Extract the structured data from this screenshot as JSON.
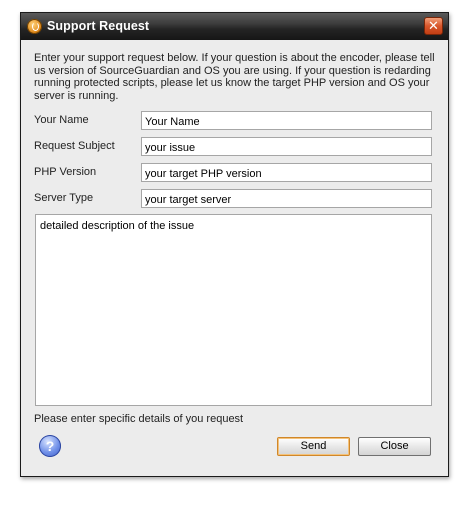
{
  "window": {
    "title": "Support Request",
    "close_glyph": "✕"
  },
  "intro_text": "Enter your support request below. If your question is about the encoder, please tell us version of SourceGuardian and OS you are using. If your question is redarding running protected scripts, please let us know the target PHP version and OS your server is running.",
  "form": {
    "name": {
      "label": "Your Name",
      "value": "Your Name"
    },
    "subject": {
      "label": "Request Subject",
      "value": "your issue"
    },
    "php_version": {
      "label": "PHP Version",
      "value": "your target PHP version"
    },
    "server_type": {
      "label": "Server Type",
      "value": "your target server"
    },
    "description": {
      "value": "detailed description of the issue"
    }
  },
  "hint_text": "Please enter specific details of you request",
  "help_glyph": "?",
  "buttons": {
    "send": "Send",
    "close": "Close"
  },
  "icons": {
    "app": "sourceguardian-app-icon",
    "help": "help-icon",
    "close": "close-icon"
  }
}
